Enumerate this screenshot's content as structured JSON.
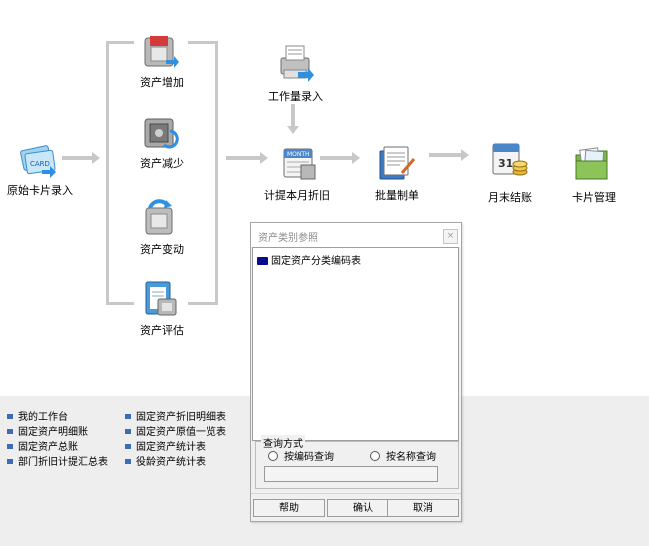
{
  "flow": {
    "card_entry": "原始卡片录入",
    "asset_add": "资产增加",
    "asset_reduce": "资产减少",
    "asset_change": "资产变动",
    "asset_evaluate": "资产评估",
    "workload_entry": "工作量录入",
    "depreciation": "计提本月折旧",
    "batch_voucher": "批量制单",
    "month_end": "月末结账",
    "card_manage": "卡片管理"
  },
  "reports": {
    "col1": [
      "我的工作台",
      "固定资产明细账",
      "固定资产总账",
      "部门折旧计提汇总表"
    ],
    "col2": [
      "固定资产折旧明细表",
      "固定资产原值一览表",
      "固定资产统计表",
      "役龄资产统计表"
    ]
  },
  "dialog": {
    "title": "资产类别参照",
    "close": "×",
    "tree_item": "固定资产分类编码表",
    "query_group": "查询方式",
    "radio_code": "按编码查询",
    "radio_name": "按名称查询",
    "query_value": "",
    "btn_help": "帮助",
    "btn_ok": "确认",
    "btn_cancel": "取消"
  },
  "colors": {
    "accent": "#3a6db5",
    "folder": "#0a0a8c",
    "bracket": "#c8c8c8"
  }
}
